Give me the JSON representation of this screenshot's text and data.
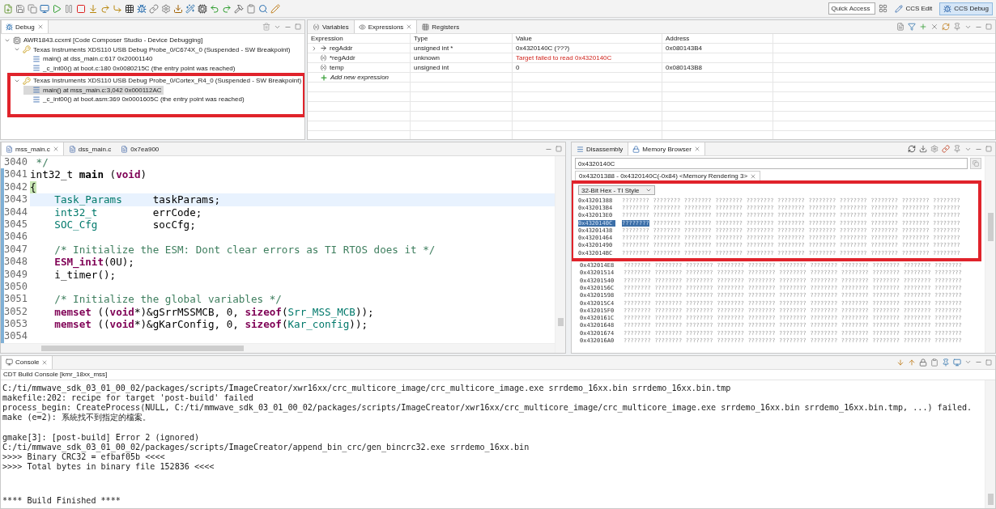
{
  "toolbar": {
    "quick_access": {
      "placeholder": "Quick Access"
    },
    "perspectives": [
      {
        "label": "CCS Edit",
        "selected": false
      },
      {
        "label": "CCS Debug",
        "selected": true
      }
    ]
  },
  "debug_view": {
    "tab": "Debug",
    "tree": [
      {
        "label": "AWR1843.ccxml [Code Composer Studio - Device Debugging]",
        "kind": "session",
        "expanded": true,
        "children": [
          {
            "label": "Texas Instruments XDS110 USB Debug Probe_0/C674X_0 (Suspended - SW Breakpoint)",
            "kind": "core",
            "expanded": true,
            "annotated": false,
            "children": [
              {
                "label": "main() at dss_main.c:617 0x20001140",
                "kind": "frame",
                "selected": false
              },
              {
                "label": "_c_int00() at boot.c:180 0x0080215C  (the entry point was reached)",
                "kind": "frame",
                "selected": false
              }
            ]
          },
          {
            "label": "Texas Instruments XDS110 USB Debug Probe_0/Cortex_R4_0 (Suspended - SW Breakpoint)",
            "kind": "core",
            "expanded": true,
            "annotated": true,
            "children": [
              {
                "label": "main() at mss_main.c:3,042 0x000112AC",
                "kind": "frame",
                "selected": true
              },
              {
                "label": "_c_int00() at boot.asm:369 0x0001605C  (the entry point was reached)",
                "kind": "frame",
                "selected": false
              }
            ]
          }
        ]
      }
    ]
  },
  "expressions_view": {
    "tabs": [
      {
        "label": "Variables",
        "selected": false
      },
      {
        "label": "Expressions",
        "selected": true
      },
      {
        "label": "Registers",
        "selected": false
      }
    ],
    "columns": [
      "Expression",
      "Type",
      "Value",
      "Address"
    ],
    "rows": [
      {
        "kind": "pointer",
        "expanded": false,
        "expression": "regAddr",
        "type": "unsigned int *",
        "value": "0x4320140C (???)",
        "address": "0x080143B4",
        "error": false
      },
      {
        "kind": "variable",
        "expression": "*regAddr",
        "type": "unknown",
        "value": "Target failed to read 0x4320140C",
        "error": true
      },
      {
        "kind": "variable",
        "expression": "temp",
        "type": "unsigned int",
        "value": "0",
        "address": "0x080143B8",
        "error": false
      },
      {
        "kind": "add",
        "expression": "Add new expression"
      }
    ]
  },
  "editor": {
    "tabs": [
      {
        "label": "mss_main.c",
        "selected": true
      },
      {
        "label": "dss_main.c",
        "selected": false
      },
      {
        "label": "0x7ea900",
        "selected": false
      }
    ],
    "lines": [
      {
        "number": "3040",
        "current": false,
        "tokens": [
          {
            "text": " */",
            "kind": "comment"
          }
        ]
      },
      {
        "number": "3041",
        "current": false,
        "tokens": [
          {
            "text": "int32_t ",
            "kind": "plain"
          },
          {
            "text": "main",
            "kind": "function"
          },
          {
            "text": " (",
            "kind": "plain"
          },
          {
            "text": "void",
            "kind": "keyword"
          },
          {
            "text": ")",
            "kind": "plain"
          }
        ]
      },
      {
        "number": "3042",
        "current": false,
        "tokens": [
          {
            "text": "{",
            "kind": "bracket"
          }
        ]
      },
      {
        "number": "3043",
        "current": true,
        "indented": true,
        "tokens": [
          {
            "text": "Task_Params",
            "kind": "type"
          },
          {
            "text": "     taskParams;",
            "kind": "plain"
          }
        ]
      },
      {
        "number": "3044",
        "current": false,
        "indented": true,
        "tokens": [
          {
            "text": "int32_t",
            "kind": "type"
          },
          {
            "text": "         errCode;",
            "kind": "plain"
          }
        ]
      },
      {
        "number": "3045",
        "current": false,
        "indented": true,
        "tokens": [
          {
            "text": "SOC_Cfg",
            "kind": "type"
          },
          {
            "text": "         socCfg;",
            "kind": "plain"
          }
        ]
      },
      {
        "number": "3046",
        "current": false
      },
      {
        "number": "3047",
        "current": false,
        "indented": true,
        "tokens": [
          {
            "text": "/* Initialize the ESM: Dont clear errors as TI RTOS does it */",
            "kind": "comment"
          }
        ]
      },
      {
        "number": "3048",
        "current": false,
        "indented": true,
        "tokens": [
          {
            "text": "ESM_init",
            "kind": "keyword"
          },
          {
            "text": "(0U);",
            "kind": "plain"
          }
        ]
      },
      {
        "number": "3049",
        "current": false,
        "indented": true,
        "tokens": [
          {
            "text": "i_timer();",
            "kind": "plain"
          }
        ]
      },
      {
        "number": "3050",
        "current": false
      },
      {
        "number": "3051",
        "current": false,
        "indented": true,
        "tokens": [
          {
            "text": "/* Initialize the global variables */",
            "kind": "comment"
          }
        ]
      },
      {
        "number": "3052",
        "current": false,
        "indented": true,
        "tokens": [
          {
            "text": "memset",
            "kind": "keyword"
          },
          {
            "text": " ((",
            "kind": "plain"
          },
          {
            "text": "void",
            "kind": "keyword"
          },
          {
            "text": "*)&gSrrMSSMCB, 0, ",
            "kind": "plain"
          },
          {
            "text": "sizeof",
            "kind": "keyword"
          },
          {
            "text": "(",
            "kind": "plain"
          },
          {
            "text": "Srr_MSS_MCB",
            "kind": "type"
          },
          {
            "text": "));",
            "kind": "plain"
          }
        ]
      },
      {
        "number": "3053",
        "current": false,
        "indented": true,
        "tokens": [
          {
            "text": "memset",
            "kind": "keyword"
          },
          {
            "text": " ((",
            "kind": "plain"
          },
          {
            "text": "void",
            "kind": "keyword"
          },
          {
            "text": "*)&gKarConfig, 0, ",
            "kind": "plain"
          },
          {
            "text": "sizeof",
            "kind": "keyword"
          },
          {
            "text": "(",
            "kind": "plain"
          },
          {
            "text": "Kar_config",
            "kind": "type"
          },
          {
            "text": "));",
            "kind": "plain"
          }
        ]
      },
      {
        "number": "3054",
        "current": false
      }
    ]
  },
  "memory_view": {
    "tabs": [
      {
        "label": "Disassembly",
        "selected": false
      },
      {
        "label": "Memory Browser",
        "selected": true
      }
    ],
    "address": "0x4320140C",
    "rendering_tab": "0x43201388 - 0x4320140C(-0x84) <Memory Rendering 3>",
    "format": "32-Bit Hex - TI Style",
    "framed_rows": [
      {
        "address": "0x43201388",
        "selected": false,
        "cells": [
          "????????",
          "????????",
          "????????",
          "????????",
          "????????",
          "????????",
          "????????",
          "????????",
          "????????",
          "????????",
          "????????"
        ]
      },
      {
        "address": "0x432013B4",
        "selected": false,
        "cells": [
          "????????",
          "????????",
          "????????",
          "????????",
          "????????",
          "????????",
          "????????",
          "????????",
          "????????",
          "????????",
          "????????"
        ]
      },
      {
        "address": "0x432013E0",
        "selected": false,
        "cells": [
          "????????",
          "????????",
          "????????",
          "????????",
          "????????",
          "????????",
          "????????",
          "????????",
          "????????",
          "????????",
          "????????"
        ]
      },
      {
        "address": "0x4320140C",
        "selected": true,
        "cells": [
          "????????",
          "????????",
          "????????",
          "????????",
          "????????",
          "????????",
          "????????",
          "????????",
          "????????",
          "????????",
          "????????"
        ]
      },
      {
        "address": "0x43201438",
        "selected": false,
        "cells": [
          "????????",
          "????????",
          "????????",
          "????????",
          "????????",
          "????????",
          "????????",
          "????????",
          "????????",
          "????????",
          "????????"
        ]
      },
      {
        "address": "0x43201464",
        "selected": false,
        "cells": [
          "????????",
          "????????",
          "????????",
          "????????",
          "????????",
          "????????",
          "????????",
          "????????",
          "????????",
          "????????",
          "????????"
        ]
      },
      {
        "address": "0x43201490",
        "selected": false,
        "cells": [
          "????????",
          "????????",
          "????????",
          "????????",
          "????????",
          "????????",
          "????????",
          "????????",
          "????????",
          "????????",
          "????????"
        ]
      },
      {
        "address": "0x432014BC",
        "selected": false,
        "cells": [
          "????????",
          "????????",
          "????????",
          "????????",
          "????????",
          "????????",
          "????????",
          "????????",
          "????????",
          "????????",
          "????????"
        ]
      }
    ],
    "rows": [
      {
        "address": "0x432014E8",
        "selected": false,
        "cells": [
          "????????",
          "????????",
          "????????",
          "????????",
          "????????",
          "????????",
          "????????",
          "????????",
          "????????",
          "????????",
          "????????"
        ]
      },
      {
        "address": "0x43201514",
        "selected": false,
        "cells": [
          "????????",
          "????????",
          "????????",
          "????????",
          "????????",
          "????????",
          "????????",
          "????????",
          "????????",
          "????????",
          "????????"
        ]
      },
      {
        "address": "0x43201540",
        "selected": false,
        "cells": [
          "????????",
          "????????",
          "????????",
          "????????",
          "????????",
          "????????",
          "????????",
          "????????",
          "????????",
          "????????",
          "????????"
        ]
      },
      {
        "address": "0x4320156C",
        "selected": false,
        "cells": [
          "????????",
          "????????",
          "????????",
          "????????",
          "????????",
          "????????",
          "????????",
          "????????",
          "????????",
          "????????",
          "????????"
        ]
      },
      {
        "address": "0x43201598",
        "selected": false,
        "cells": [
          "????????",
          "????????",
          "????????",
          "????????",
          "????????",
          "????????",
          "????????",
          "????????",
          "????????",
          "????????",
          "????????"
        ]
      },
      {
        "address": "0x432015C4",
        "selected": false,
        "cells": [
          "????????",
          "????????",
          "????????",
          "????????",
          "????????",
          "????????",
          "????????",
          "????????",
          "????????",
          "????????",
          "????????"
        ]
      },
      {
        "address": "0x432015F0",
        "selected": false,
        "cells": [
          "????????",
          "????????",
          "????????",
          "????????",
          "????????",
          "????????",
          "????????",
          "????????",
          "????????",
          "????????",
          "????????"
        ]
      },
      {
        "address": "0x4320161C",
        "selected": false,
        "cells": [
          "????????",
          "????????",
          "????????",
          "????????",
          "????????",
          "????????",
          "????????",
          "????????",
          "????????",
          "????????",
          "????????"
        ]
      },
      {
        "address": "0x43201648",
        "selected": false,
        "cells": [
          "????????",
          "????????",
          "????????",
          "????????",
          "????????",
          "????????",
          "????????",
          "????????",
          "????????",
          "????????",
          "????????"
        ]
      },
      {
        "address": "0x43201674",
        "selected": false,
        "cells": [
          "????????",
          "????????",
          "????????",
          "????????",
          "????????",
          "????????",
          "????????",
          "????????",
          "????????",
          "????????",
          "????????"
        ]
      },
      {
        "address": "0x432016A0",
        "selected": false,
        "cells": [
          "????????",
          "????????",
          "????????",
          "????????",
          "????????",
          "????????",
          "????????",
          "????????",
          "????????",
          "????????",
          "????????"
        ]
      }
    ]
  },
  "console": {
    "tab": "Console",
    "title": "CDT Build Console [kmr_18xx_mss]",
    "blocks": [
      [
        "C:/ti/mmwave_sdk_03_01_00_02/packages/scripts/ImageCreator/xwr16xx/crc_multicore_image/crc_multicore_image.exe srrdemo_16xx.bin srrdemo_16xx.bin.tmp",
        "makefile:202: recipe for target 'post-build' failed",
        "process_begin: CreateProcess(NULL, C:/ti/mmwave_sdk_03_01_00_02/packages/scripts/ImageCreator/xwr16xx/crc_multicore_image/crc_multicore_image.exe srrdemo_16xx.bin srrdemo_16xx.bin.tmp, ...) failed.",
        "make (e=2): 系統找不到指定的檔案。"
      ],
      [
        "gmake[3]: [post-build] Error 2 (ignored)",
        "C:/ti/mmwave_sdk_03_01_00_02/packages/scripts/ImageCreator/append_bin_crc/gen_bincrc32.exe srrdemo_16xx.bin",
        ">>>> Binary CRC32 = efbaf05b <<<<",
        ">>>> Total bytes in binary file 152836 <<<<"
      ]
    ],
    "footer": "**** Build Finished ****"
  }
}
